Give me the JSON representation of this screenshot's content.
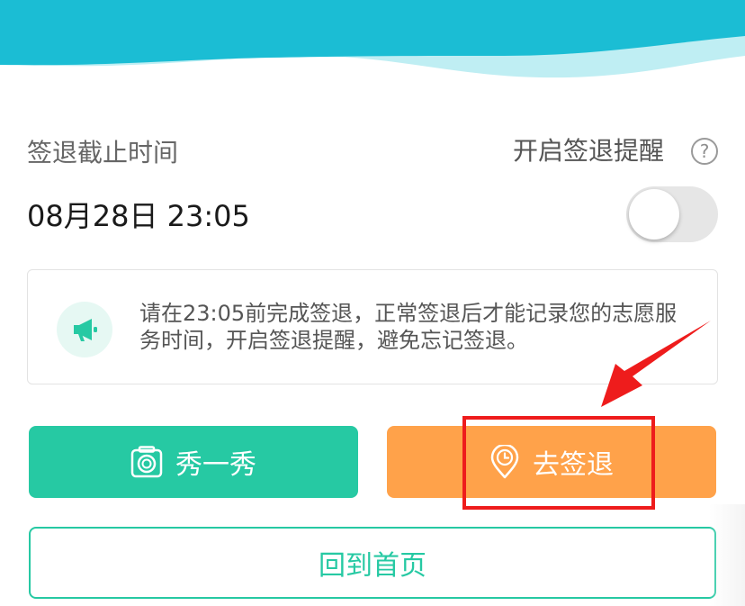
{
  "header": {
    "wave_color": "#1bbdd4",
    "wave_light_color": "#bfeef3"
  },
  "signout": {
    "deadline_label": "签退截止时间",
    "deadline_value": "08月28日 23:05",
    "reminder_label": "开启签退提醒",
    "help_glyph": "?",
    "reminder_enabled": false
  },
  "notice": {
    "icon": "megaphone-icon",
    "text": "请在23:05前完成签退，正常签退后才能记录您的志愿服务时间，开启签退提醒，避免忘记签退。"
  },
  "actions": {
    "show_label": "秀一秀",
    "show_icon": "camera-icon",
    "signout_label": "去签退",
    "signout_icon": "location-clock-icon",
    "home_label": "回到首页"
  },
  "colors": {
    "primary": "#26c9a3",
    "accent": "#ffa24a",
    "annotation": "#ee1c1c"
  }
}
